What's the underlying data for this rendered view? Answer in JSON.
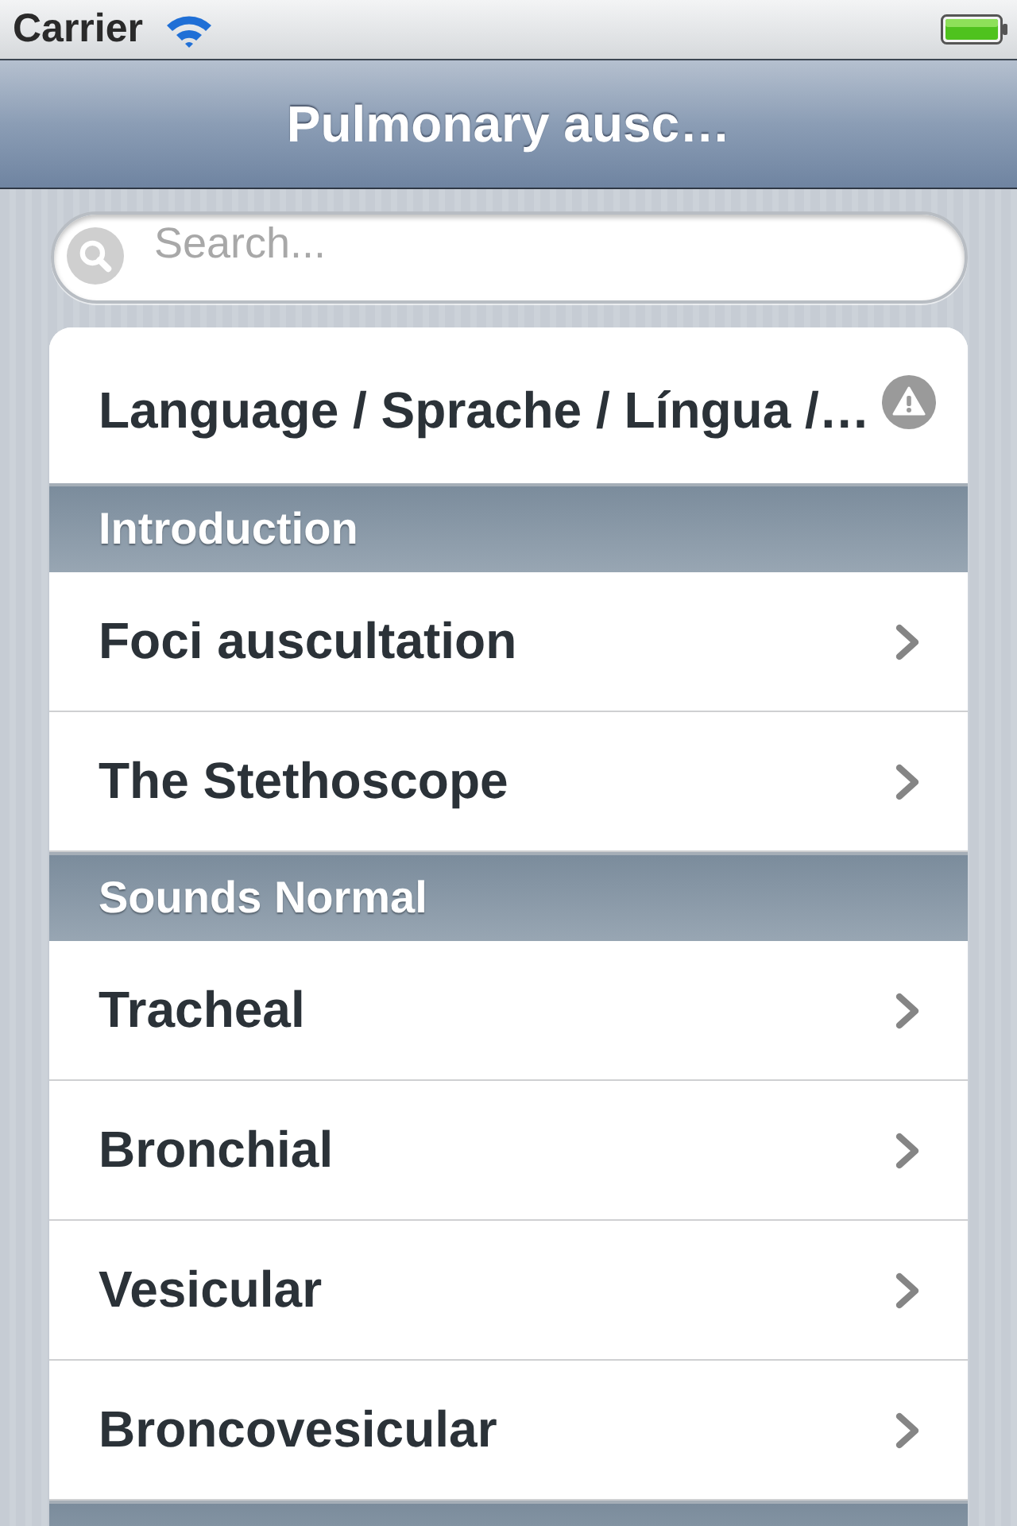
{
  "status_bar": {
    "carrier": "Carrier"
  },
  "nav_bar": {
    "title": "Pulmonary ausc…"
  },
  "search": {
    "placeholder": "Search..."
  },
  "list": [
    {
      "kind": "row",
      "label": "Language / Sprache / Língua /…",
      "accessory": {
        "kind": "warning"
      }
    },
    {
      "kind": "header",
      "label": "Introduction"
    },
    {
      "kind": "row",
      "label": "Foci auscultation",
      "accessory": {
        "kind": "chevron"
      }
    },
    {
      "kind": "row",
      "label": "The Stethoscope",
      "accessory": {
        "kind": "chevron"
      }
    },
    {
      "kind": "header",
      "label": "Sounds Normal"
    },
    {
      "kind": "row",
      "label": "Tracheal",
      "accessory": {
        "kind": "chevron"
      }
    },
    {
      "kind": "row",
      "label": "Bronchial",
      "accessory": {
        "kind": "chevron"
      }
    },
    {
      "kind": "row",
      "label": "Vesicular",
      "accessory": {
        "kind": "chevron"
      }
    },
    {
      "kind": "row",
      "label": "Broncovesicular",
      "accessory": {
        "kind": "chevron"
      }
    },
    {
      "kind": "header"
    }
  ]
}
